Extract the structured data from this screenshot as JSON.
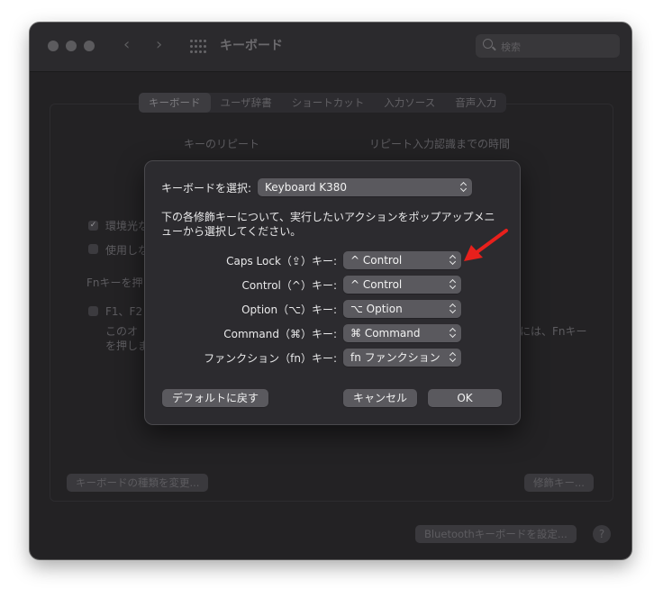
{
  "window": {
    "title": "キーボード",
    "search_placeholder": "検索",
    "tabs": [
      "キーボード",
      "ユーザ辞書",
      "ショートカット",
      "入力ソース",
      "音声入力"
    ],
    "key_repeat_label": "キーのリピート",
    "repeat_delay_label": "リピート入力認識までの時間",
    "ambient_check_label": "環境光な",
    "unused_check_label": "使用しな",
    "fn_label": "Fnキーを押",
    "f_keys_label": "F1、F2",
    "note_line1": "このオ",
    "note_line1_right": "には、Fnキー",
    "note_line2": "を押しま",
    "change_type_button": "キーボードの種類を変更...",
    "modifier_keys_button": "修飾キー...",
    "bluetooth_button": "Bluetoothキーボードを設定...",
    "help_label": "?"
  },
  "sheet": {
    "select_label": "キーボードを選択:",
    "keyboard_value": "Keyboard K380",
    "desc_line1": "下の各修飾キーについて、実行したいアクションをポップアップメニ",
    "desc_line2": "ューから選択してください。",
    "rows": [
      {
        "label": "Caps Lock（⇪）キー:",
        "value": "^ Control"
      },
      {
        "label": "Control（^）キー:",
        "value": "^ Control"
      },
      {
        "label": "Option（⌥）キー:",
        "value": "⌥ Option"
      },
      {
        "label": "Command（⌘）キー:",
        "value": "⌘ Command"
      },
      {
        "label": "ファンクション（fn）キー:",
        "value": "fn ファンクション"
      }
    ],
    "defaults_button": "デフォルトに戻す",
    "cancel_button": "キャンセル",
    "ok_button": "OK"
  },
  "colors": {
    "annotation_arrow": "#e8201c",
    "window_bg": "#232224",
    "sheet_bg": "#2c2b2f"
  }
}
